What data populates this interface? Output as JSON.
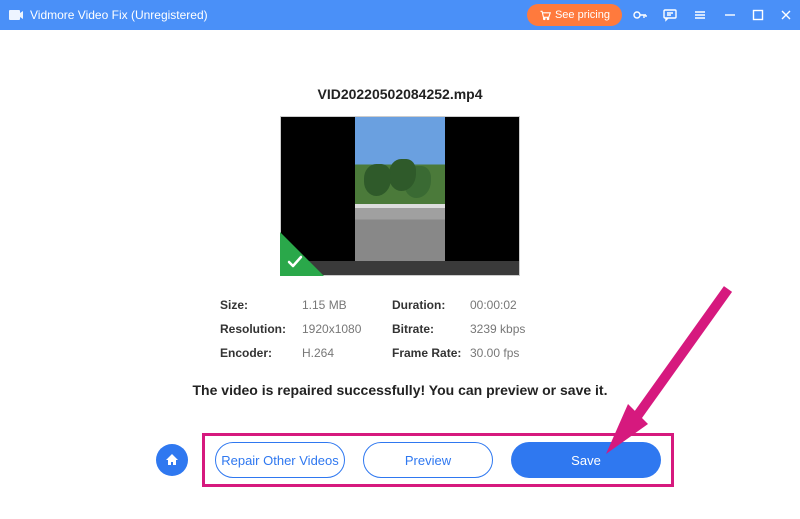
{
  "titlebar": {
    "app_name": "Vidmore Video Fix",
    "status": "(Unregistered)",
    "see_pricing": "See pricing"
  },
  "filename": "VID20220502084252.mp4",
  "metadata": {
    "size_label": "Size:",
    "size": "1.15 MB",
    "duration_label": "Duration:",
    "duration": "00:00:02",
    "resolution_label": "Resolution:",
    "resolution": "1920x1080",
    "bitrate_label": "Bitrate:",
    "bitrate": "3239 kbps",
    "encoder_label": "Encoder:",
    "encoder": "H.264",
    "framerate_label": "Frame Rate:",
    "framerate": "30.00 fps"
  },
  "status_message": "The video is repaired successfully! You can preview or save it.",
  "buttons": {
    "repair_other": "Repair Other Videos",
    "preview": "Preview",
    "save": "Save"
  }
}
